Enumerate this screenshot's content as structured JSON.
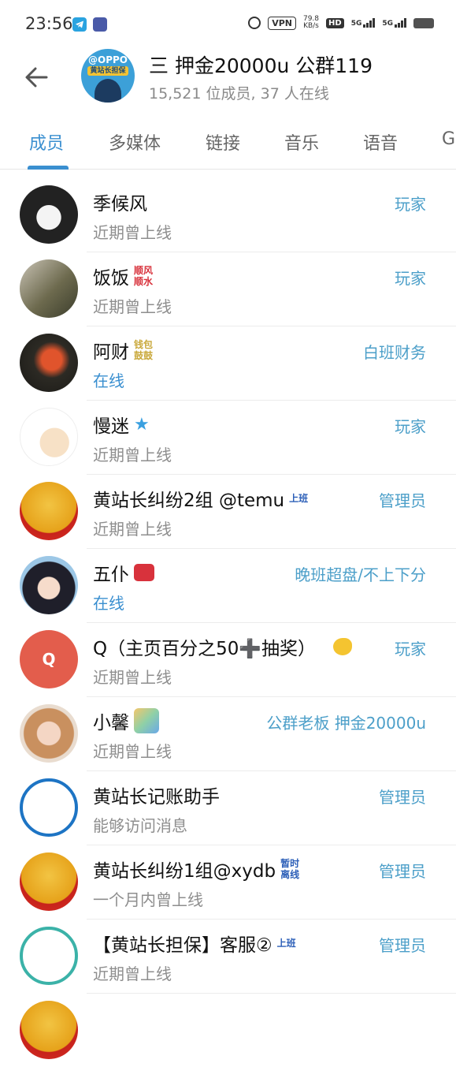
{
  "status_bar": {
    "time": "23:56",
    "vpn": "VPN",
    "speed_value": "79.8",
    "speed_unit": "KB/s",
    "hd": "HD",
    "net1": "5G",
    "net2": "5G"
  },
  "header": {
    "group_avatar_text": "@OPPO",
    "group_avatar_badge": "黄站长担保",
    "title": "三 押金20000u   公群119",
    "subtitle": "15,521 位成员, 37 人在线"
  },
  "tabs": [
    {
      "label": "成员"
    },
    {
      "label": "多媒体"
    },
    {
      "label": "链接"
    },
    {
      "label": "音乐"
    },
    {
      "label": "语音"
    },
    {
      "label": "G"
    }
  ],
  "members": [
    {
      "name": "季候风",
      "status": "近期曾上线",
      "role": "玩家",
      "tag": ""
    },
    {
      "name": "饭饭",
      "status": "近期曾上线",
      "role": "玩家",
      "tag": "顺风顺水"
    },
    {
      "name": "阿财",
      "status": "在线",
      "role": "白班财务",
      "tag": "钱包鼓鼓"
    },
    {
      "name": "慢迷",
      "status": "近期曾上线",
      "role": "玩家",
      "tag": "★"
    },
    {
      "name": "黄站长纠纷2组 @temu",
      "status": "近期曾上线",
      "role": "管理员",
      "tag": "上班"
    },
    {
      "name": "五仆",
      "status": "在线",
      "role": "晚班超盘/不上下分",
      "tag": ""
    },
    {
      "name": "Q（主页百分之50➕抽奖）",
      "status": "近期曾上线",
      "role": "玩家",
      "tag": "",
      "letter": "Q"
    },
    {
      "name": "小馨",
      "status": "近期曾上线",
      "role": "公群老板 押金20000u",
      "tag": ""
    },
    {
      "name": "黄站长记账助手",
      "status": "能够访问消息",
      "role": "管理员",
      "tag": ""
    },
    {
      "name": "黄站长纠纷1组@xydb",
      "status": "一个月内曾上线",
      "role": "管理员",
      "tag": "暂时离线"
    },
    {
      "name": "【黄站长担保】客服②",
      "status": "近期曾上线",
      "role": "管理员",
      "tag": "上班"
    }
  ],
  "colors": {
    "accent": "#3a8fd0",
    "role_text": "#4c9fc9",
    "muted_text": "#8e8e8e"
  }
}
